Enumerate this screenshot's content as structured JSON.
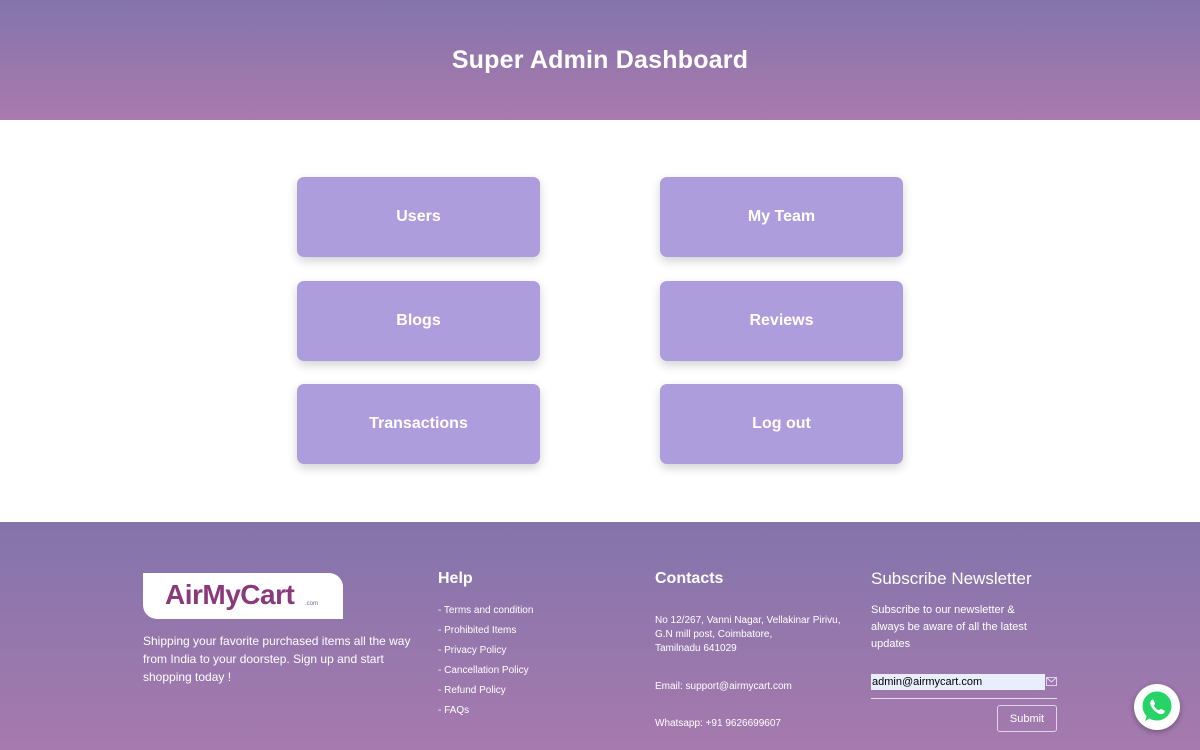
{
  "header": {
    "title": "Super Admin Dashboard"
  },
  "tiles": [
    {
      "label": "Users"
    },
    {
      "label": "My Team"
    },
    {
      "label": "Blogs"
    },
    {
      "label": "Reviews"
    },
    {
      "label": "Transactions"
    },
    {
      "label": "Log out"
    }
  ],
  "footer": {
    "logo": {
      "text_main": "AirMyCart",
      "text_suffix": ".com"
    },
    "tagline": "Shipping your favorite purchased items all the way from India to your doorstep. Sign up and start shopping today !",
    "help": {
      "title": "Help",
      "links": [
        "- Terms and condition",
        "- Prohibited Items",
        "- Privacy Policy",
        "- Cancellation Policy",
        "- Refund Policy",
        "- FAQs"
      ]
    },
    "contacts": {
      "title": "Contacts",
      "address_lines": [
        "No 12/267, Vanni Nagar, Vellakinar Pirivu,",
        "G.N mill post, Coimbatore,",
        "Tamilnadu 641029"
      ],
      "email": "Email: support@airmycart.com",
      "whatsapp": "Whatsapp: +91 9626699607"
    },
    "newsletter": {
      "title": "Subscribe Newsletter",
      "description": "Subscribe to our newsletter & always be aware of all the latest updates",
      "email_value": "admin@airmycart.com",
      "submit_label": "Submit"
    }
  },
  "icons": {
    "mail": "mail-icon",
    "whatsapp": "whatsapp-icon"
  },
  "colors": {
    "tile": "#ae9ddd",
    "gradient_top": "#8474ab",
    "gradient_bottom": "#a97aae",
    "whatsapp": "#25d366"
  }
}
